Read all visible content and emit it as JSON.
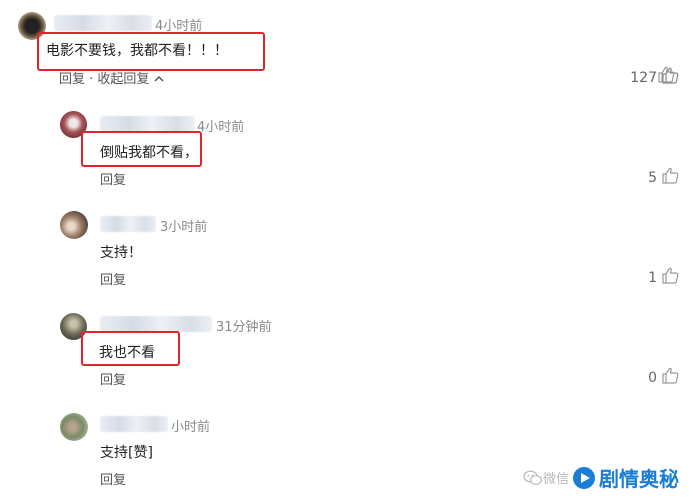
{
  "comments": [
    {
      "time": "4小时前",
      "text": "电影不要钱，我都不看！！！",
      "reply_label": "回复 · 收起回复",
      "likes": "127"
    },
    {
      "time": "4小时前",
      "text": "倒贴我都不看，",
      "reply_label": "回复",
      "likes": "5"
    },
    {
      "time": "3小时前",
      "text": "支持！",
      "reply_label": "回复",
      "likes": "1"
    },
    {
      "time": "31分钟前",
      "text": "我也不看",
      "reply_label": "回复",
      "likes": "0"
    },
    {
      "time": "小时前",
      "text": "支持[赞]",
      "reply_label": "回复",
      "likes": ""
    }
  ],
  "watermark": {
    "wechat_text": "微信",
    "brand": "剧情奥秘",
    "brand_color": "#1a7ed6"
  },
  "colors": {
    "highlight": "#e0262c",
    "muted": "#8a8a8a"
  }
}
